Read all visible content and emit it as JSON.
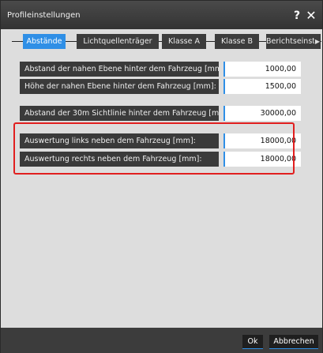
{
  "window": {
    "title": "Profileinstellungen",
    "help_label": "?",
    "close_label": "✕"
  },
  "tabs": [
    {
      "label": "Abstände",
      "active": true
    },
    {
      "label": "Lichtquellenträger",
      "active": false
    },
    {
      "label": "Klasse A",
      "active": false
    },
    {
      "label": "Klasse B",
      "active": false
    },
    {
      "label": "Berichtseinst",
      "active": false
    }
  ],
  "tab_scroll_icon": "chevron-right-icon",
  "fields": [
    {
      "label": "Abstand der nahen Ebene hinter dem Fahrzeug [mm]:",
      "value": "1000,00"
    },
    {
      "label": "Höhe der nahen Ebene hinter dem Fahrzeug [mm]:",
      "value": "1500,00"
    },
    {
      "label": "Abstand der 30m Sichtlinie hinter dem Fahrzeug [mm]:",
      "value": "30000,00"
    },
    {
      "label": "Auswertung links neben dem Fahrzeug [mm]:",
      "value": "18000,00"
    },
    {
      "label": "Auswertung rechts neben dem Fahrzeug [mm]:",
      "value": "18000,00"
    }
  ],
  "footer": {
    "ok_label": "Ok",
    "cancel_label": "Abbrechen"
  },
  "colors": {
    "accent": "#2f8fe6",
    "highlight": "#e11f1f",
    "titlebar": "#333333",
    "label_bg": "#3a3a3a"
  }
}
